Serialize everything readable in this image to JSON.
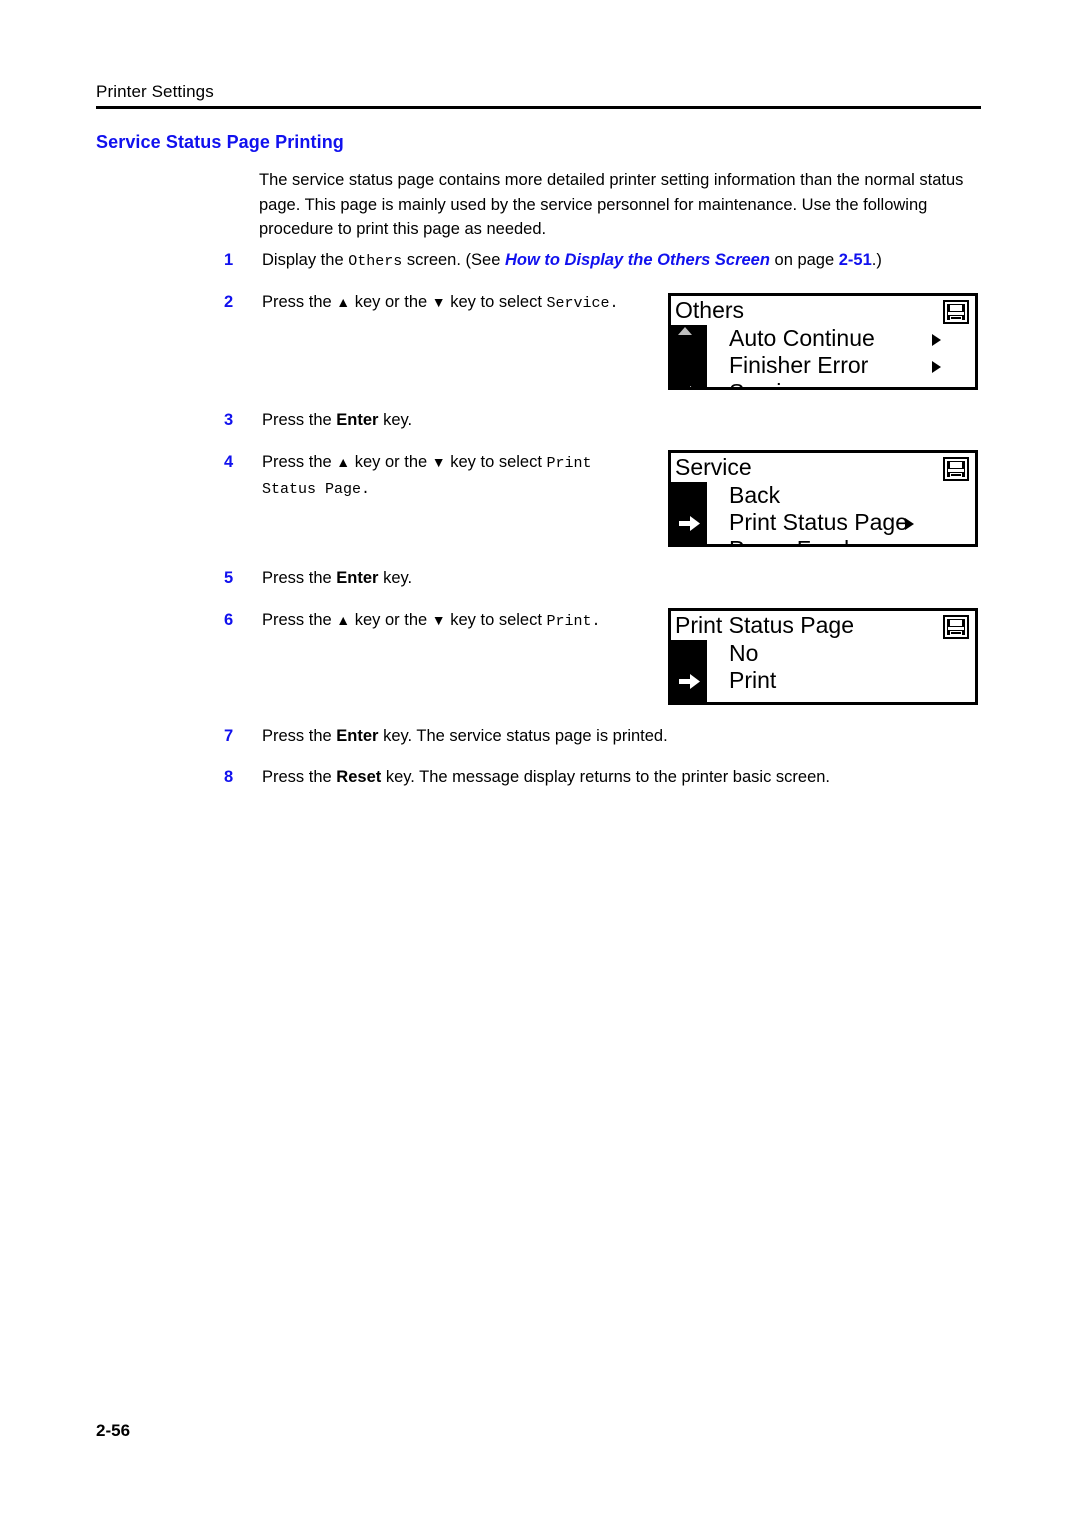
{
  "header": {
    "running_title": "Printer Settings"
  },
  "section": {
    "heading": "Service Status Page Printing",
    "intro": "The service status page contains more detailed printer setting information than the normal status page. This page is mainly used by the service personnel for maintenance. Use the following procedure to print this page as needed."
  },
  "steps": [
    {
      "number": "1",
      "parts": {
        "t1": "Display the ",
        "code1": "Others",
        "t2": " screen. (See ",
        "xref": "How to Display the Others Screen",
        "t3": " on page ",
        "pageref": "2-51",
        "t4": ".)"
      }
    },
    {
      "number": "2",
      "parts": {
        "t1": "Press the ",
        "up": "▲",
        "t2": " key or the ",
        "down": "▼",
        "t3": " key to select ",
        "code1": "Service.",
        "t4": ""
      }
    },
    {
      "number": "3",
      "parts": {
        "t1": "Press the ",
        "bold1": "Enter",
        "t2": " key.",
        "t3": "",
        "t4": ""
      }
    },
    {
      "number": "4",
      "parts": {
        "t1": "Press the ",
        "up": "▲",
        "t2": " key or the ",
        "down": "▼",
        "t3": " key to select ",
        "code1": "Print Status Page.",
        "t4": ""
      }
    },
    {
      "number": "5",
      "parts": {
        "t1": "Press the ",
        "bold1": "Enter",
        "t2": " key.",
        "t3": "",
        "t4": ""
      }
    },
    {
      "number": "6",
      "parts": {
        "t1": "Press the ",
        "up": "▲",
        "t2": " key or the ",
        "down": "▼",
        "t3": " key to select ",
        "code1": "Print.",
        "t4": ""
      }
    },
    {
      "number": "7",
      "parts": {
        "t1": "Press the ",
        "bold1": "Enter",
        "t2": " key. The service status page is printed.",
        "t3": "",
        "t4": ""
      }
    },
    {
      "number": "8",
      "parts": {
        "t1": "Press the ",
        "bold1": "Reset",
        "t2": " key. The message display returns to the printer basic screen.",
        "t3": "",
        "t4": ""
      }
    }
  ],
  "lcd_panels": [
    {
      "title": "Others",
      "icon": "printer-icon",
      "scroll_up_indicator": true,
      "rows": [
        {
          "label": "Auto Continue",
          "submenu_arrow": true,
          "selected": false
        },
        {
          "label": "Finisher Error",
          "submenu_arrow": true,
          "selected": false
        },
        {
          "label": "Service",
          "submenu_arrow": true,
          "selected": true
        }
      ]
    },
    {
      "title": "Service",
      "icon": "printer-icon",
      "scroll_up_indicator": false,
      "rows": [
        {
          "label": "Back",
          "submenu_arrow": false,
          "selected": false
        },
        {
          "label": "Print Status Page",
          "submenu_arrow": true,
          "selected": true
        },
        {
          "label": "Paper Feed",
          "submenu_arrow": true,
          "selected": false
        }
      ]
    },
    {
      "title": "Print Status Page",
      "icon": "printer-icon",
      "scroll_up_indicator": false,
      "rows": [
        {
          "label": "No",
          "submenu_arrow": false,
          "selected": false
        },
        {
          "label": "Print",
          "submenu_arrow": false,
          "selected": true
        }
      ]
    }
  ],
  "footer": {
    "page_number": "2-56"
  },
  "colors": {
    "accent_blue": "#1111ee",
    "text_black": "#000000",
    "page_background": "#ffffff"
  }
}
